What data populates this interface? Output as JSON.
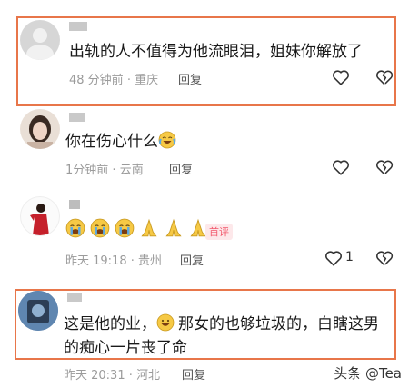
{
  "comments": [
    {
      "text": "出轨的人不值得为他流眼泪，姐妹你解放了",
      "time": "48 分钟前",
      "location": "重庆",
      "reply_label": "回复"
    },
    {
      "text": "你在伤心什么",
      "time": "1分钟前",
      "location": "云南",
      "reply_label": "回复"
    },
    {
      "time": "昨天 19:18",
      "location": "贵州",
      "reply_label": "回复",
      "badge": "首评",
      "like_count": "1"
    },
    {
      "text_line1_a": "这是他的业，",
      "text_line1_b": "那女的也够垃圾的，白瞎这男",
      "text_line2": "的痴心一片丧了命",
      "time": "昨天 20:31",
      "location": "河北",
      "reply_label": "回复"
    }
  ],
  "separator": "·",
  "watermark": "头条 @Tea"
}
